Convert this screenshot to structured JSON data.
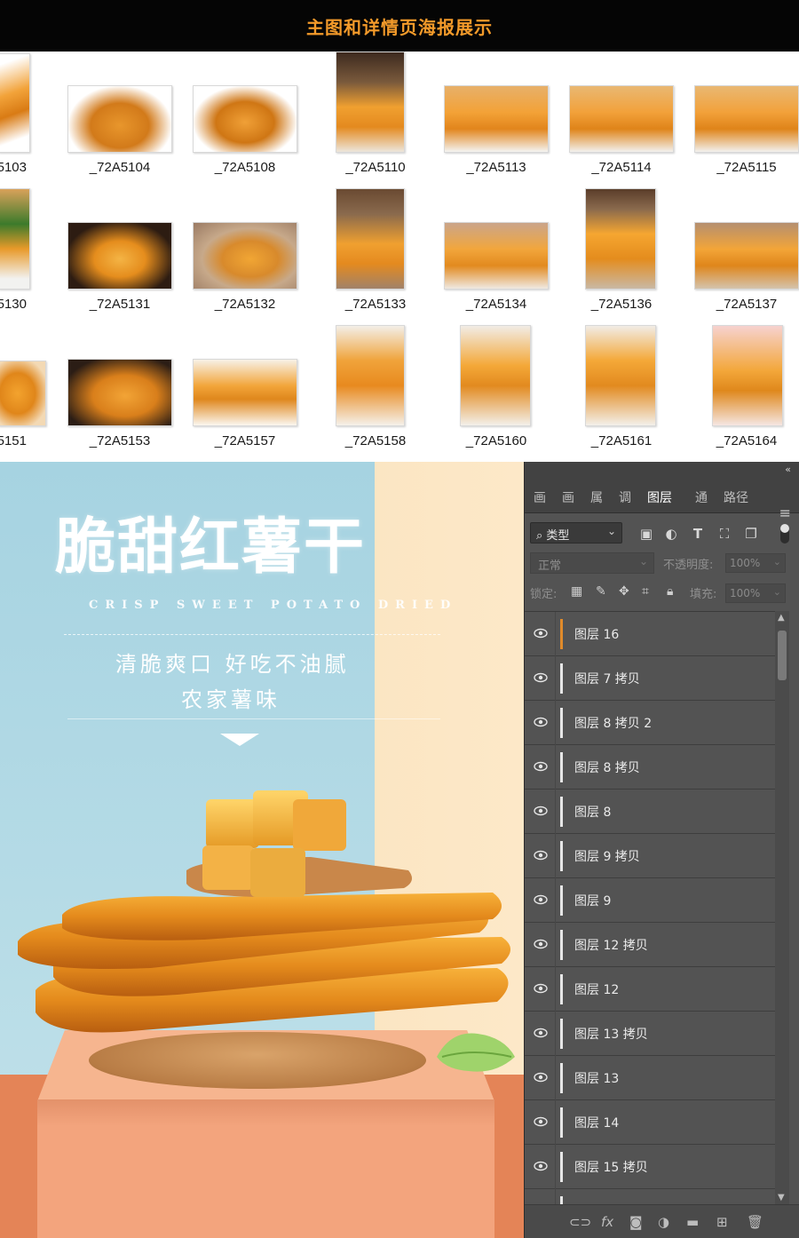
{
  "header": {
    "title": "主图和详情页海报展示"
  },
  "thumbnails": {
    "rows": [
      {
        "captions": [
          "5103",
          "_72A5104",
          "_72A5108",
          "_72A5110",
          "_72A5113",
          "_72A5114",
          "_72A5115"
        ]
      },
      {
        "captions": [
          "5130",
          "_72A5131",
          "_72A5132",
          "_72A5133",
          "_72A5134",
          "_72A5136",
          "_72A5137"
        ]
      },
      {
        "captions": [
          "5151",
          "_72A5153",
          "_72A5157",
          "_72A5158",
          "_72A5160",
          "_72A5161",
          "_72A5164"
        ]
      }
    ]
  },
  "poster": {
    "title": "脆甜红薯干",
    "subtitle_en": "CRISP SWEET POTATO DRIED",
    "tagline_1": "清脆爽口  好吃不油腻",
    "tagline_2": "农家薯味"
  },
  "photoshop": {
    "tabs": [
      "画",
      "画",
      "属",
      "调",
      "图层",
      "通",
      "路径"
    ],
    "active_tab": "图层",
    "filter_label": "类型",
    "blend_mode": "正常",
    "opacity_label": "不透明度:",
    "opacity_value": "100%",
    "lock_label": "锁定:",
    "fill_label": "填充:",
    "fill_value": "100%",
    "layers": [
      {
        "name": "图层 16"
      },
      {
        "name": "图层 7 拷贝"
      },
      {
        "name": "图层 8 拷贝 2"
      },
      {
        "name": "图层 8 拷贝"
      },
      {
        "name": "图层 8"
      },
      {
        "name": "图层 9 拷贝"
      },
      {
        "name": "图层 9"
      },
      {
        "name": "图层 12 拷贝"
      },
      {
        "name": "图层 12"
      },
      {
        "name": "图层 13 拷贝"
      },
      {
        "name": "图层 13"
      },
      {
        "name": "图层 14"
      },
      {
        "name": "图层 15 拷贝"
      }
    ],
    "bottom_icons": [
      "link-icon",
      "fx-icon",
      "mask-icon",
      "adjustment-icon",
      "folder-icon",
      "new-layer-icon",
      "trash-icon"
    ]
  },
  "colors": {
    "header_text": "#f39a2a",
    "ps_panel": "#535353",
    "poster_blue": "#a6d3e1",
    "poster_cream": "#fde8c8",
    "pedestal": "#f3a47d"
  }
}
